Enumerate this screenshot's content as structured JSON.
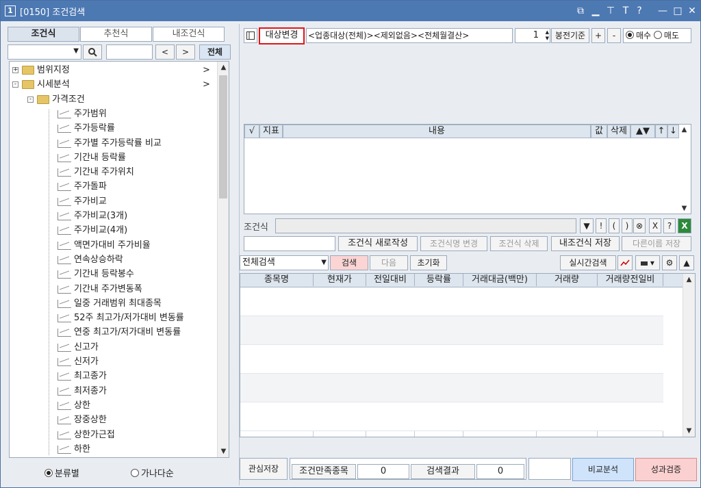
{
  "window": {
    "num": "1",
    "title": "[0150] 조건검색",
    "ctl": [
      "⧉",
      "▁",
      "⊤",
      "T",
      "?",
      "—",
      "□",
      "✕"
    ]
  },
  "left": {
    "tabs": [
      "조건식",
      "추천식",
      "내조건식"
    ],
    "all_btn": "전체",
    "nav": [
      "<",
      ">"
    ],
    "tree": [
      {
        "label": "범위지정",
        "level": 0,
        "type": "folder",
        "pm": "+",
        "arrow": ">"
      },
      {
        "label": "시세분석",
        "level": 0,
        "type": "folder",
        "pm": "-",
        "arrow": ">"
      },
      {
        "label": "가격조건",
        "level": 1,
        "type": "folder",
        "pm": "-"
      },
      {
        "label": "주가범위",
        "level": 2,
        "type": "item"
      },
      {
        "label": "주가등락률",
        "level": 2,
        "type": "item"
      },
      {
        "label": "주가별 주가등락률 비교",
        "level": 2,
        "type": "item"
      },
      {
        "label": "기간내 등락률",
        "level": 2,
        "type": "item"
      },
      {
        "label": "기간내 주가위치",
        "level": 2,
        "type": "item"
      },
      {
        "label": "주가돌파",
        "level": 2,
        "type": "item"
      },
      {
        "label": "주가비교",
        "level": 2,
        "type": "item"
      },
      {
        "label": "주가비교(3개)",
        "level": 2,
        "type": "item"
      },
      {
        "label": "주가비교(4개)",
        "level": 2,
        "type": "item"
      },
      {
        "label": "액면가대비 주가비율",
        "level": 2,
        "type": "item"
      },
      {
        "label": "연속상승하락",
        "level": 2,
        "type": "item"
      },
      {
        "label": "기간내 등락봉수",
        "level": 2,
        "type": "item"
      },
      {
        "label": "기간내 주가변동폭",
        "level": 2,
        "type": "item"
      },
      {
        "label": "일중 거래범위 최대종목",
        "level": 2,
        "type": "item"
      },
      {
        "label": "52주 최고가/저가대비 변동률",
        "level": 2,
        "type": "item"
      },
      {
        "label": "연중 최고가/저가대비 변동률",
        "level": 2,
        "type": "item"
      },
      {
        "label": "신고가",
        "level": 2,
        "type": "item"
      },
      {
        "label": "신저가",
        "level": 2,
        "type": "item"
      },
      {
        "label": "최고종가",
        "level": 2,
        "type": "item"
      },
      {
        "label": "최저종가",
        "level": 2,
        "type": "item"
      },
      {
        "label": "상한",
        "level": 2,
        "type": "item"
      },
      {
        "label": "장중상한",
        "level": 2,
        "type": "item"
      },
      {
        "label": "상한가근접",
        "level": 2,
        "type": "item"
      },
      {
        "label": "하한",
        "level": 2,
        "type": "item"
      }
    ],
    "radios": [
      {
        "label": "분류별",
        "on": true
      },
      {
        "label": "가나다순",
        "on": false
      }
    ]
  },
  "right": {
    "target_btn": "대상변경",
    "target_text": "<업종대상(전체)><제외없음><전체월결산>",
    "bong_value": "1",
    "bong_label": "봉전기준",
    "plus": "+",
    "minus": "-",
    "buy": "매수",
    "sell": "매도",
    "cond_headers": [
      "√",
      "지표",
      "내용",
      "값",
      "삭제",
      "▲▼",
      "↑",
      "↓"
    ],
    "cond_label": "조건식",
    "cond_ops": [
      "▼",
      "!",
      "(",
      ")",
      "⊗",
      "X",
      "?"
    ],
    "actions": [
      "조건식 새로작성",
      "조건식명 변경",
      "조건식 삭제",
      "내조건식 저장",
      "다른이름 저장"
    ],
    "search_type": "전체검색",
    "search_btn": "검색",
    "next_btn": "다음",
    "reset_btn": "초기화",
    "realtime_btn": "실시간검색",
    "result_headers": [
      "종목명",
      "현재가",
      "전일대비",
      "등락률",
      "거래대금(백만)",
      "거래량",
      "거래량전일비"
    ],
    "bottom": {
      "save": "관심저장",
      "satisfy_label": "조건만족종목",
      "satisfy_val": "0",
      "result_label": "검색결과",
      "result_val": "0",
      "compare": "비교분석",
      "verify": "성과검증"
    }
  }
}
